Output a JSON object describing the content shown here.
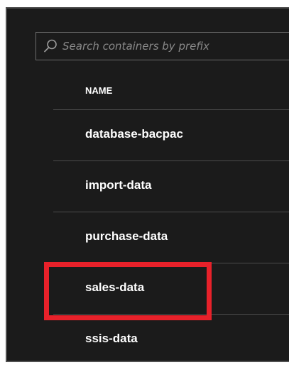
{
  "search": {
    "placeholder": "Search containers by prefix",
    "value": ""
  },
  "table": {
    "column_header": "NAME",
    "rows": [
      {
        "name": "database-bacpac"
      },
      {
        "name": "import-data"
      },
      {
        "name": "purchase-data"
      },
      {
        "name": "sales-data",
        "highlighted": true
      },
      {
        "name": "ssis-data"
      }
    ]
  },
  "icons": {
    "search": "search-icon"
  },
  "colors": {
    "background": "#1b1b1b",
    "text": "#ffffff",
    "placeholder": "#8a8a8a",
    "highlight": "#e8212a",
    "divider": "#4c4c4c"
  }
}
